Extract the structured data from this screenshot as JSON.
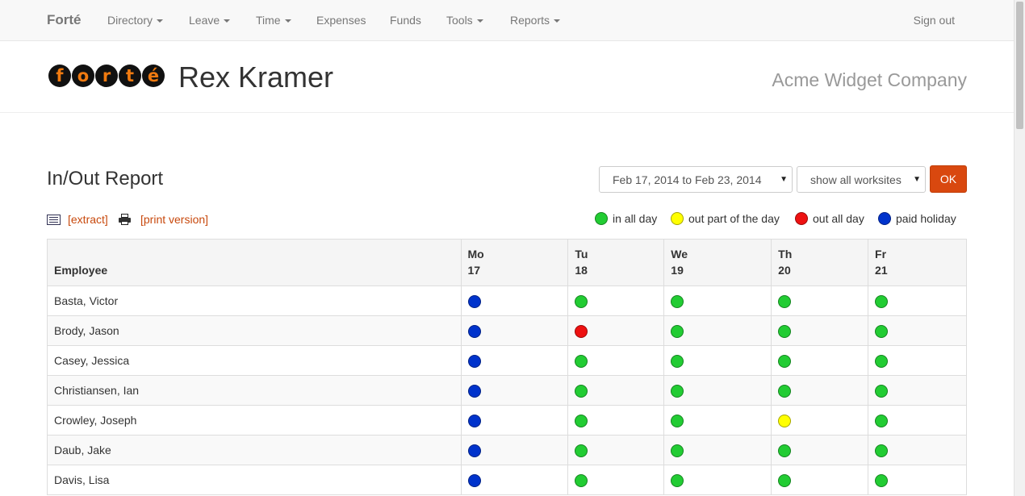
{
  "navbar": {
    "brand": "Forté",
    "items": [
      {
        "label": "Directory",
        "dropdown": true
      },
      {
        "label": "Leave",
        "dropdown": true
      },
      {
        "label": "Time",
        "dropdown": true
      },
      {
        "label": "Expenses",
        "dropdown": false
      },
      {
        "label": "Funds",
        "dropdown": false
      },
      {
        "label": "Tools",
        "dropdown": true
      },
      {
        "label": "Reports",
        "dropdown": true
      }
    ],
    "sign_out": "Sign out"
  },
  "header": {
    "logo_letters": [
      "f",
      "o",
      "r",
      "t",
      "é"
    ],
    "user_name": "Rex Kramer",
    "company": "Acme Widget Company"
  },
  "report": {
    "title": "In/Out Report",
    "date_range": "Feb 17, 2014 to Feb 23, 2014",
    "worksite_filter": "show all worksites",
    "ok_label": "OK",
    "extract_label": "[extract]",
    "print_label": "[print version]"
  },
  "legend": [
    {
      "label": "in all day",
      "color": "#22cc33"
    },
    {
      "label": "out part of the day",
      "color": "#ffff00"
    },
    {
      "label": "out all day",
      "color": "#ee1111"
    },
    {
      "label": "paid holiday",
      "color": "#0033cc"
    }
  ],
  "status_colors": {
    "in": "#22cc33",
    "part": "#ffff00",
    "out": "#ee1111",
    "holiday": "#0033cc"
  },
  "table": {
    "employee_header": "Employee",
    "days": [
      {
        "day": "Mo",
        "date": "17"
      },
      {
        "day": "Tu",
        "date": "18"
      },
      {
        "day": "We",
        "date": "19"
      },
      {
        "day": "Th",
        "date": "20"
      },
      {
        "day": "Fr",
        "date": "21"
      }
    ],
    "rows": [
      {
        "name": "Basta, Victor",
        "status": [
          "holiday",
          "in",
          "in",
          "in",
          "in"
        ]
      },
      {
        "name": "Brody, Jason",
        "status": [
          "holiday",
          "out",
          "in",
          "in",
          "in"
        ]
      },
      {
        "name": "Casey, Jessica",
        "status": [
          "holiday",
          "in",
          "in",
          "in",
          "in"
        ]
      },
      {
        "name": "Christiansen, Ian",
        "status": [
          "holiday",
          "in",
          "in",
          "in",
          "in"
        ]
      },
      {
        "name": "Crowley, Joseph",
        "status": [
          "holiday",
          "in",
          "in",
          "part",
          "in"
        ]
      },
      {
        "name": "Daub, Jake",
        "status": [
          "holiday",
          "in",
          "in",
          "in",
          "in"
        ]
      },
      {
        "name": "Davis, Lisa",
        "status": [
          "holiday",
          "in",
          "in",
          "in",
          "in"
        ]
      }
    ]
  }
}
